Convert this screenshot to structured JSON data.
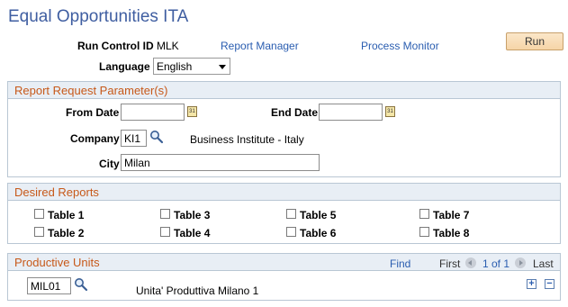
{
  "page": {
    "title": "Equal Opportunities ITA"
  },
  "header": {
    "run_control_label": "Run Control ID",
    "run_control_value": "MLK",
    "report_manager": "Report Manager",
    "process_monitor": "Process Monitor",
    "run_button": "Run",
    "language_label": "Language",
    "language_value": "English"
  },
  "params": {
    "heading": "Report Request Parameter(s)",
    "from_date_label": "From Date",
    "from_date_value": "",
    "end_date_label": "End Date",
    "end_date_value": "",
    "company_label": "Company",
    "company_value": "KI1",
    "company_desc": "Business Institute - Italy",
    "city_label": "City",
    "city_value": "Milan",
    "calendar_glyph": "31"
  },
  "reports": {
    "heading": "Desired Reports",
    "items": [
      {
        "label": "Table 1"
      },
      {
        "label": "Table 2"
      },
      {
        "label": "Table 3"
      },
      {
        "label": "Table 4"
      },
      {
        "label": "Table 5"
      },
      {
        "label": "Table 6"
      },
      {
        "label": "Table 7"
      },
      {
        "label": "Table 8"
      }
    ]
  },
  "units": {
    "heading": "Productive Units",
    "find": "Find",
    "first": "First",
    "counter": "1 of 1",
    "last": "Last",
    "rows": [
      {
        "code": "MIL01",
        "desc": "Unita' Produttiva Milano 1"
      }
    ],
    "add_glyph": "+",
    "remove_glyph": "−"
  },
  "colors": {
    "title": "#3f5ea1",
    "section_heading": "#c7591a",
    "link": "#2a5db0"
  },
  "icons": {
    "calendar": "calendar-icon",
    "lookup": "lookup-icon"
  }
}
